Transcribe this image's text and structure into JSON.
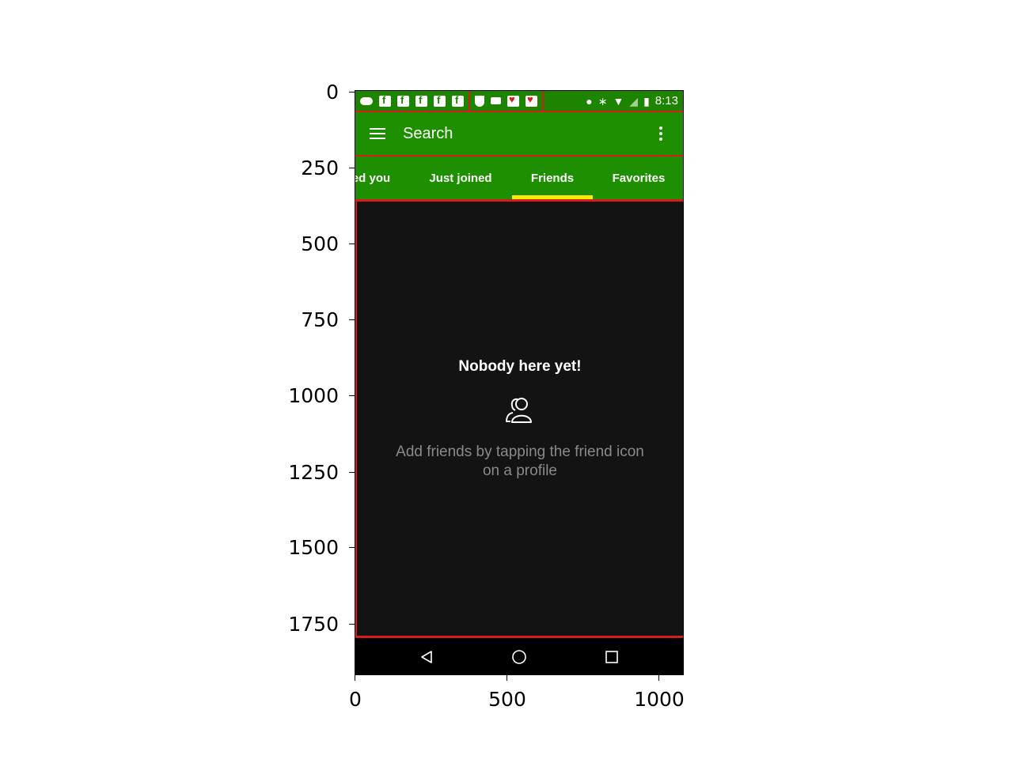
{
  "axes": {
    "y_ticks": [
      "0",
      "250",
      "500",
      "750",
      "1000",
      "1250",
      "1500",
      "1750"
    ],
    "x_ticks": [
      "0",
      "500",
      "1000"
    ]
  },
  "status_bar": {
    "time": "8:13",
    "left_icons": [
      "message-icon",
      "facebook-icon",
      "facebook-icon",
      "facebook-icon",
      "facebook-icon",
      "facebook-icon"
    ],
    "middle_icons": [
      "shield-icon",
      "card-icon",
      "heart-app-icon",
      "heart-app-icon"
    ],
    "right_icons": [
      "location-icon",
      "bluetooth-icon",
      "wifi-icon",
      "signal-icon",
      "battery-charging-icon"
    ]
  },
  "app_bar": {
    "title": "Search",
    "menu_icon": "hamburger-menu-icon",
    "overflow_icon": "more-vert-icon"
  },
  "tabs": [
    {
      "label": "ed you",
      "active": false
    },
    {
      "label": "Just joined",
      "active": false
    },
    {
      "label": "Friends",
      "active": true
    },
    {
      "label": "Favorites",
      "active": false
    }
  ],
  "empty_state": {
    "title": "Nobody here yet!",
    "icon": "friends-icon",
    "description": "Add friends by tapping the friend icon on a profile"
  },
  "nav_bar": {
    "back_icon": "back-triangle-icon",
    "home_icon": "home-circle-icon",
    "recents_icon": "recents-square-icon"
  },
  "colors": {
    "primary": "#1d8f00",
    "status_bar": "#1d8400",
    "tab_indicator": "#ffeb00",
    "background": "#131313",
    "annotation_border": "#d81b1b"
  }
}
